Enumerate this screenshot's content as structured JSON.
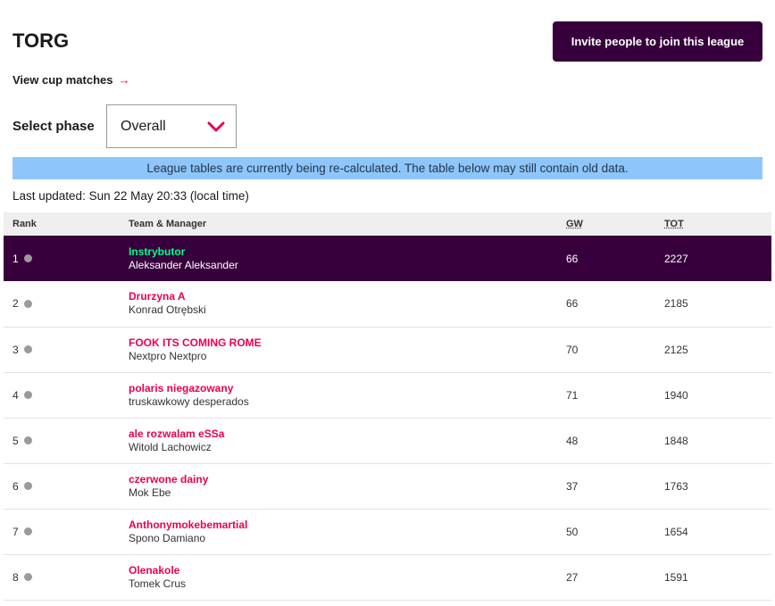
{
  "league": {
    "title": "TORG",
    "invite_label": "Invite people to join this league",
    "cup_link_label": "View cup matches",
    "cup_link_arrow": "→"
  },
  "phase": {
    "label": "Select phase",
    "selected": "Overall"
  },
  "notice": "League tables are currently being re-calculated. The table below may still contain old data.",
  "last_updated": "Last updated: Sun 22 May 20:33 (local time)",
  "table": {
    "headers": {
      "rank": "Rank",
      "team": "Team & Manager",
      "gw": "GW",
      "tot": "TOT"
    },
    "rows": [
      {
        "rank": "1",
        "team": "Instrybutor",
        "manager": "Aleksander Aleksander",
        "gw": "66",
        "tot": "2227"
      },
      {
        "rank": "2",
        "team": "Drurzyna A",
        "manager": "Konrad Otrębski",
        "gw": "66",
        "tot": "2185"
      },
      {
        "rank": "3",
        "team": "FOOK ITS COMING ROME",
        "manager": "Nextpro Nextpro",
        "gw": "70",
        "tot": "2125"
      },
      {
        "rank": "4",
        "team": "polaris niegazowany",
        "manager": "truskawkowy desperados",
        "gw": "71",
        "tot": "1940"
      },
      {
        "rank": "5",
        "team": "ale rozwalam eSSa",
        "manager": "Witold Lachowicz",
        "gw": "48",
        "tot": "1848"
      },
      {
        "rank": "6",
        "team": "czerwone dainy",
        "manager": "Mok Ebe",
        "gw": "37",
        "tot": "1763"
      },
      {
        "rank": "7",
        "team": "Anthonymokebemartial",
        "manager": "Spono Damiano",
        "gw": "50",
        "tot": "1654"
      },
      {
        "rank": "8",
        "team": "Olenakole",
        "manager": "Tomek Crus",
        "gw": "27",
        "tot": "1591"
      }
    ]
  },
  "colors": {
    "brand": "#37003c",
    "accent": "#e90052",
    "highlight_team": "#00ff87",
    "notice_bg": "#8ec6fb"
  },
  "icons": {
    "phase_dropdown": "chevron-down-icon",
    "cup_link": "arrow-right-icon",
    "rank_movement": "status-dot-icon"
  }
}
